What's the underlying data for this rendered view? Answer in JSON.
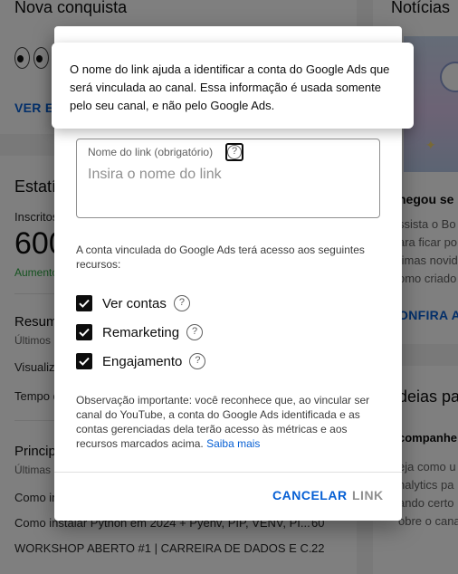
{
  "background": {
    "achievement": {
      "title": "Nova conquista",
      "link": "VER ES"
    },
    "stats": {
      "title": "Estatí",
      "subs_label": "Inscritos",
      "subs_value": "600",
      "growth": "Aumento",
      "summary_title": "Resum",
      "summary_period": "Últimos",
      "views_label": "Visualiz",
      "watch_label": "Tempo d"
    },
    "top_videos": {
      "title": "Princip",
      "period": "Últimas",
      "rows": [
        {
          "title": "Como in",
          "value": ""
        },
        {
          "title": "Como instalar Python em 2024 + Pyenv, PIP, VENV, PI...",
          "value": "60"
        },
        {
          "title": "WORKSHOP ABERTO #1 | CARREIRA DE DADOS E C...",
          "value": "22"
        }
      ]
    },
    "news": {
      "title": "Notícias",
      "headline": "hegou se",
      "lines": [
        "ssista o Bo",
        "ara ficar po",
        "timas novid",
        "omo criado"
      ],
      "link": "ONFIRA A"
    },
    "ideas": {
      "title": "deias pa",
      "subtitle": "companhe",
      "lines": [
        "eja como u",
        "nalytics pa",
        "ando certo",
        "obre o cana"
      ]
    }
  },
  "tooltip": {
    "text": "O nome do link ajuda a identificar a conta do Google Ads que será vinculada ao canal. Essa informação é usada somente pelo seu canal, e não pelo Google Ads."
  },
  "dialog": {
    "field": {
      "label": "Nome do link (obrigatório)",
      "placeholder": "Insira o nome do link",
      "value": "",
      "help_icon": "help-circle-icon"
    },
    "access_text": "A conta vinculada do Google Ads terá acesso aos seguintes recursos:",
    "permissions": [
      {
        "label": "Ver contas",
        "checked": true
      },
      {
        "label": "Remarketing",
        "checked": true
      },
      {
        "label": "Engajamento",
        "checked": true
      }
    ],
    "note": "Observação importante: você reconhece que, ao vincular ser canal do YouTube, a conta do Google Ads identificada e as contas gerenciadas dela terão acesso às métricas e aos recursos marcados acima.",
    "learn_more": "Saiba mais",
    "cancel_label": "CANCELAR",
    "link_label": "LINK"
  },
  "colors": {
    "accent": "#065fd4",
    "scrim": "rgba(0,0,0,0.5)",
    "disabled": "#909090",
    "checkbox": "#0d0d0d"
  }
}
